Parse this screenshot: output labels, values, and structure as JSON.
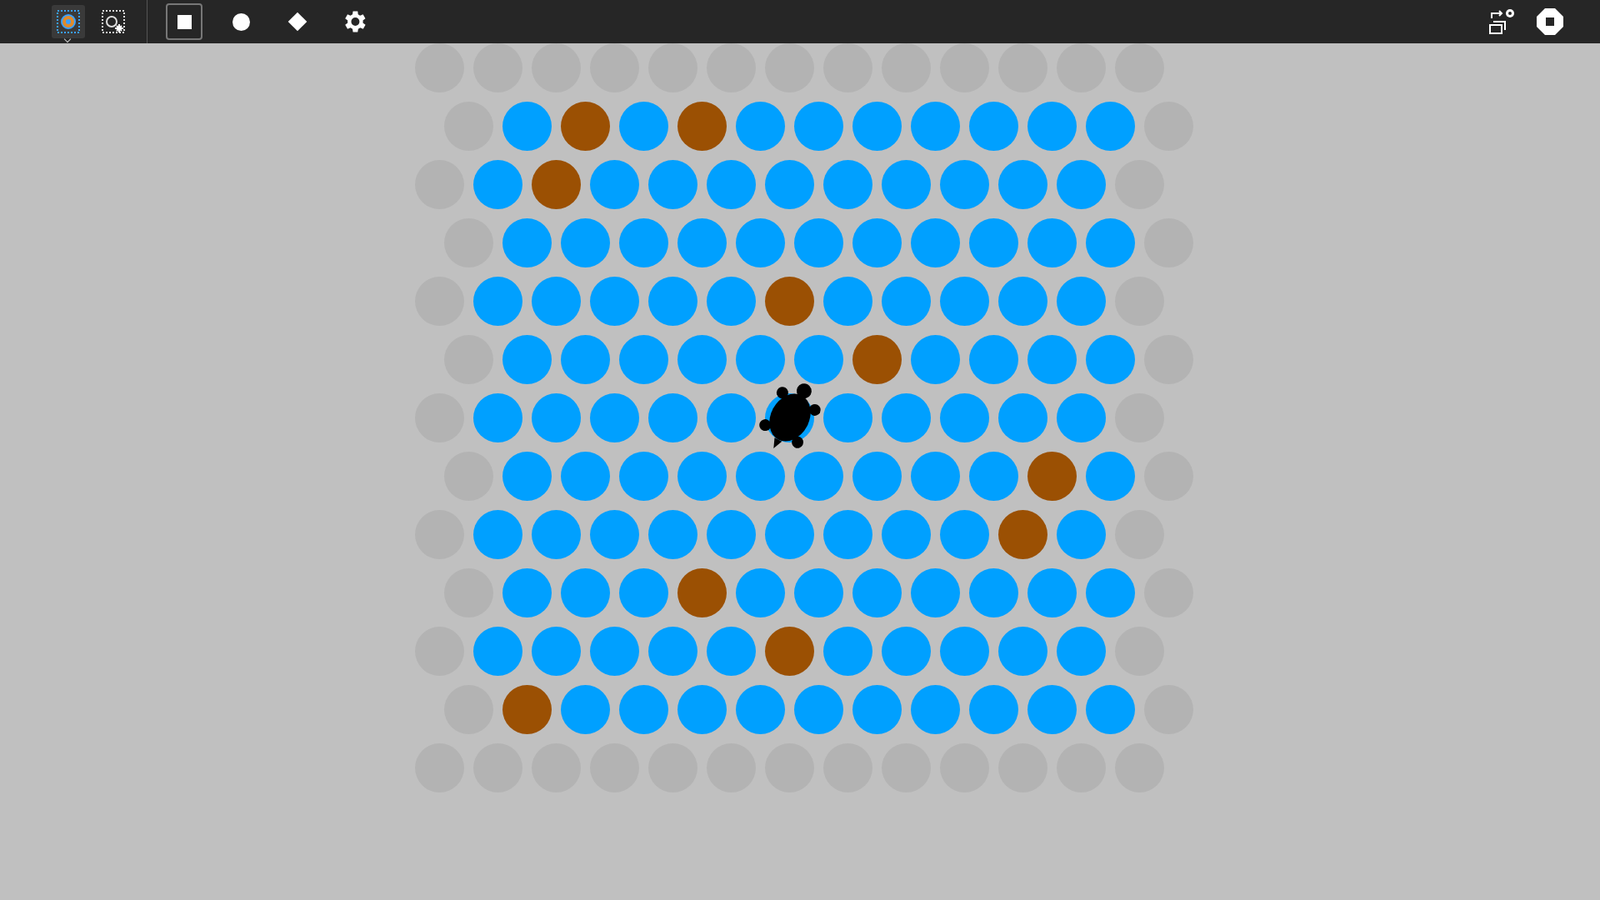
{
  "toolbar": {
    "left_buttons": [
      {
        "selected": true
      },
      {
        "selected": false
      }
    ],
    "shape_buttons": [
      {
        "selected": true
      },
      {
        "selected": false
      },
      {
        "selected": false
      }
    ]
  },
  "board": {
    "rows": [
      [
        "edge",
        "edge",
        "edge",
        "edge",
        "edge",
        "edge",
        "edge",
        "edge",
        "edge",
        "edge",
        "edge",
        "edge",
        "edge"
      ],
      [
        "edge",
        "open",
        "blocked",
        "open",
        "blocked",
        "open",
        "open",
        "open",
        "open",
        "open",
        "open",
        "open",
        "edge"
      ],
      [
        "edge",
        "open",
        "blocked",
        "open",
        "open",
        "open",
        "open",
        "open",
        "open",
        "open",
        "open",
        "open",
        "edge"
      ],
      [
        "edge",
        "open",
        "open",
        "open",
        "open",
        "open",
        "open",
        "open",
        "open",
        "open",
        "open",
        "open",
        "edge"
      ],
      [
        "edge",
        "open",
        "open",
        "open",
        "open",
        "open",
        "blocked",
        "open",
        "open",
        "open",
        "open",
        "open",
        "edge"
      ],
      [
        "edge",
        "open",
        "open",
        "open",
        "open",
        "open",
        "open",
        "blocked",
        "open",
        "open",
        "open",
        "open",
        "edge"
      ],
      [
        "edge",
        "open",
        "open",
        "open",
        "open",
        "open",
        "open",
        "open",
        "open",
        "open",
        "open",
        "open",
        "edge"
      ],
      [
        "edge",
        "open",
        "open",
        "open",
        "open",
        "open",
        "open",
        "open",
        "open",
        "open",
        "blocked",
        "open",
        "edge"
      ],
      [
        "edge",
        "open",
        "open",
        "open",
        "open",
        "open",
        "open",
        "open",
        "open",
        "open",
        "blocked",
        "open",
        "edge"
      ],
      [
        "edge",
        "open",
        "open",
        "open",
        "blocked",
        "open",
        "open",
        "open",
        "open",
        "open",
        "open",
        "open",
        "edge"
      ],
      [
        "edge",
        "open",
        "open",
        "open",
        "open",
        "open",
        "blocked",
        "open",
        "open",
        "open",
        "open",
        "open",
        "edge"
      ],
      [
        "edge",
        "blocked",
        "open",
        "open",
        "open",
        "open",
        "open",
        "open",
        "open",
        "open",
        "open",
        "open",
        "edge"
      ],
      [
        "edge",
        "edge",
        "edge",
        "edge",
        "edge",
        "edge",
        "edge",
        "edge",
        "edge",
        "edge",
        "edge",
        "edge",
        "edge"
      ]
    ],
    "turtle": {
      "row": 6,
      "col": 6
    }
  }
}
